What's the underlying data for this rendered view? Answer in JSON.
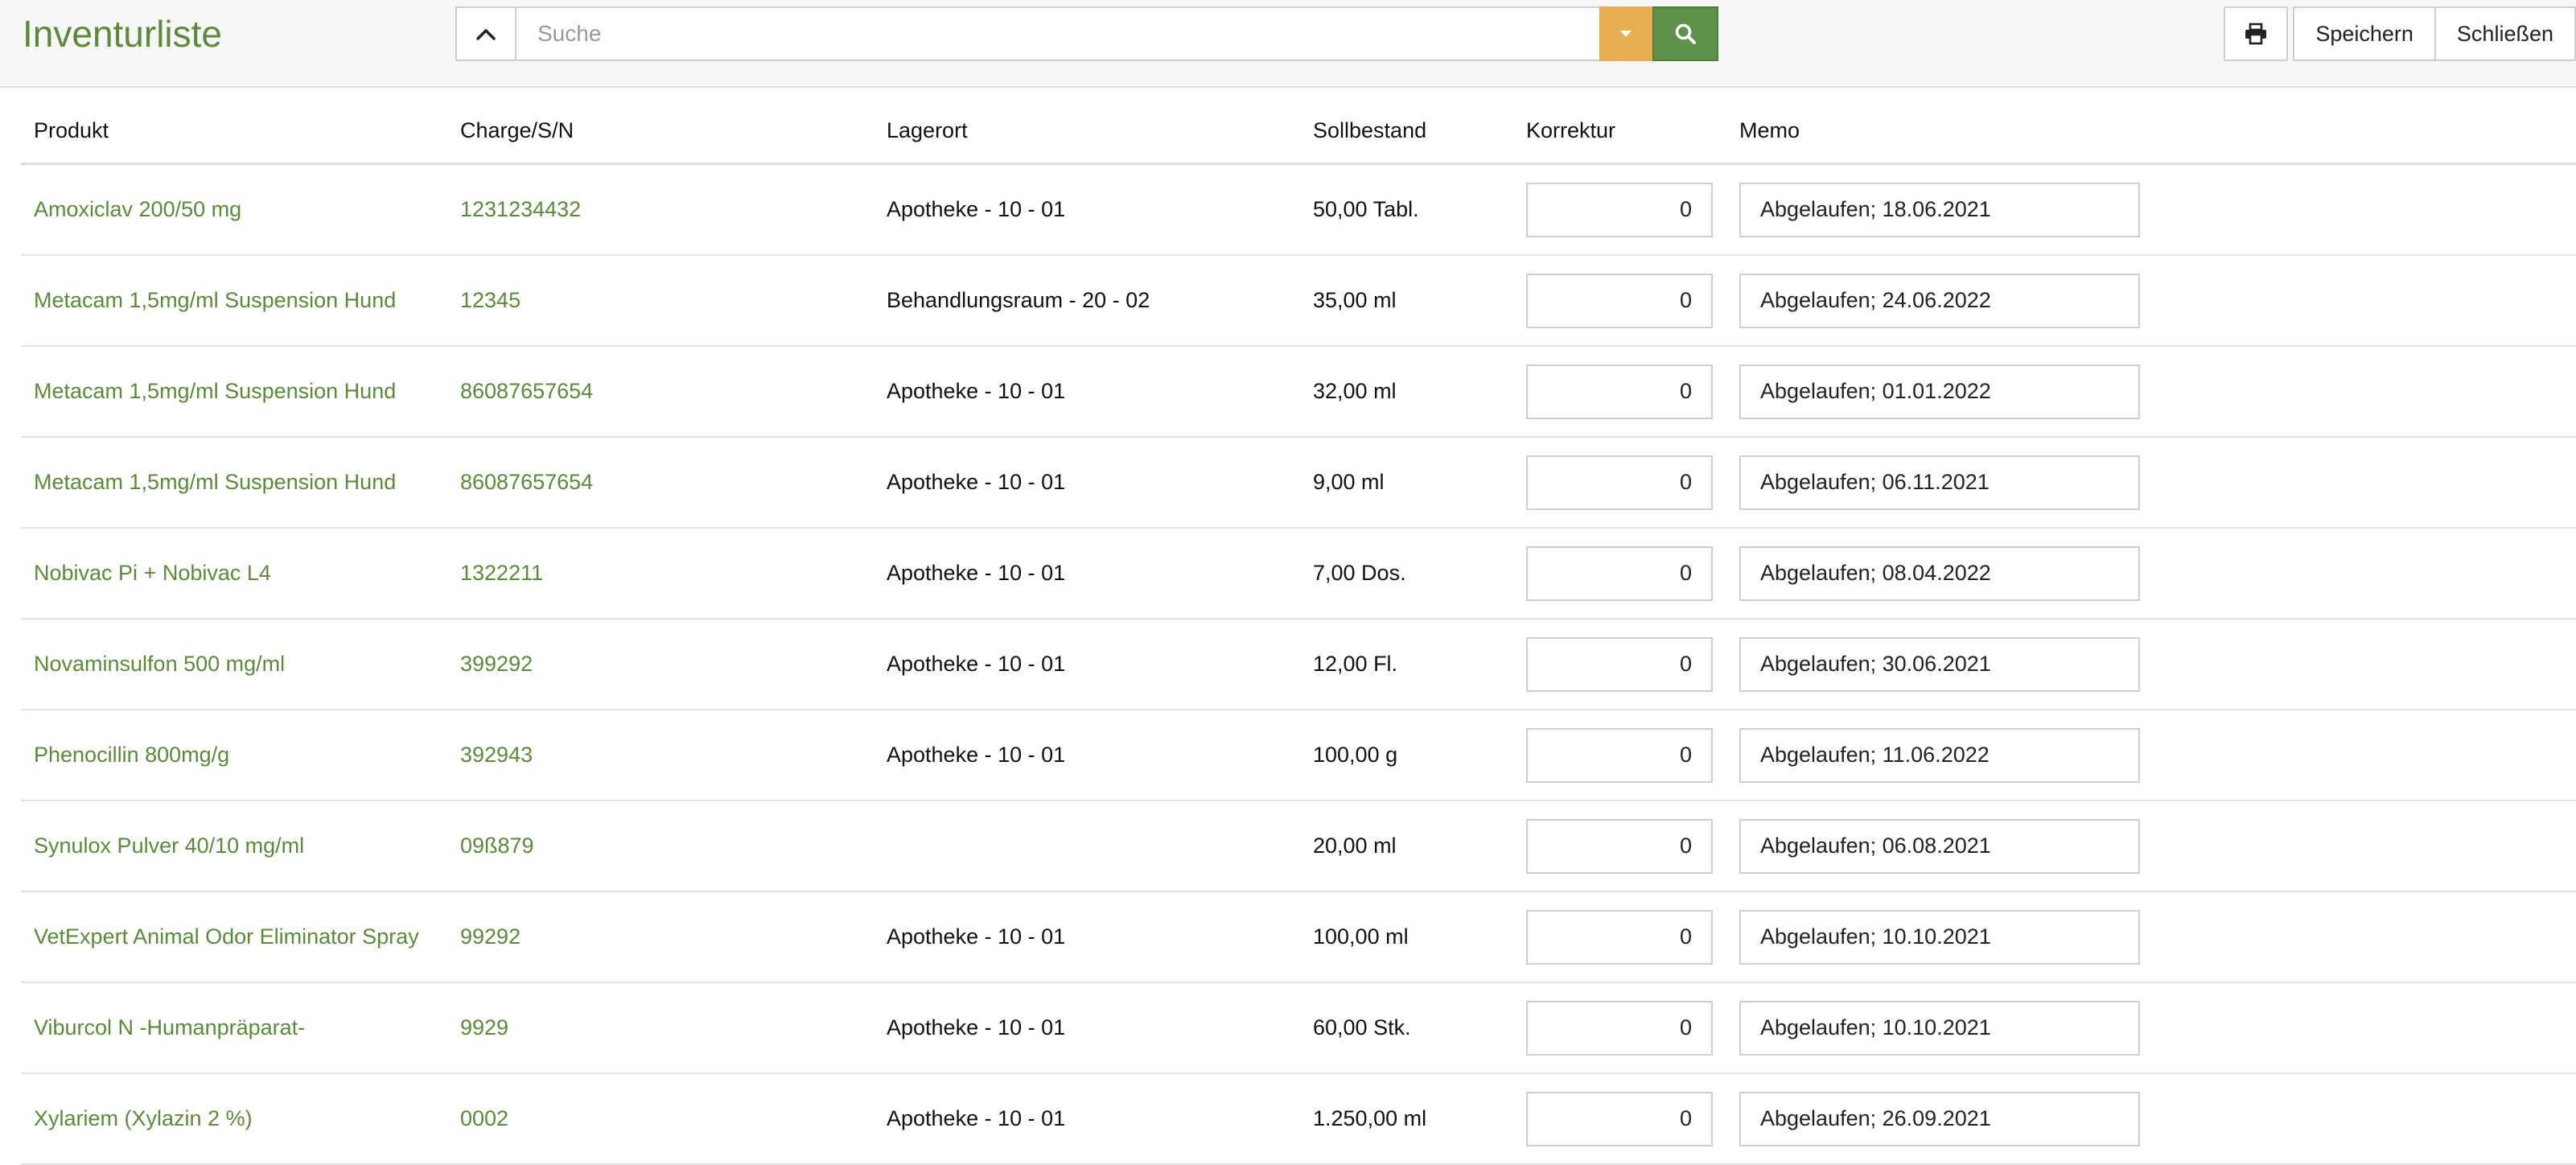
{
  "app": {
    "title": "Inventurliste"
  },
  "search": {
    "placeholder": "Suche",
    "value": ""
  },
  "toolbar": {
    "save_label": "Speichern",
    "close_label": "Schließen"
  },
  "colors": {
    "brand_green": "#5a8a3a",
    "dropdown_orange": "#e8ae52",
    "search_green": "#5e9248"
  },
  "table": {
    "headers": [
      "Produkt",
      "Charge/S/N",
      "Lagerort",
      "Sollbestand",
      "Korrektur",
      "Memo"
    ],
    "rows": [
      {
        "product": "Amoxiclav 200/50 mg",
        "charge": "1231234432",
        "location": "Apotheke - 10 - 01",
        "target": "50,00 Tabl.",
        "correction": "0",
        "memo": "Abgelaufen; 18.06.2021"
      },
      {
        "product": "Metacam 1,5mg/ml Suspension Hund",
        "charge": "12345",
        "location": "Behandlungsraum - 20 - 02",
        "target": "35,00 ml",
        "correction": "0",
        "memo": "Abgelaufen; 24.06.2022"
      },
      {
        "product": "Metacam 1,5mg/ml Suspension Hund",
        "charge": "86087657654",
        "location": "Apotheke - 10 - 01",
        "target": "32,00 ml",
        "correction": "0",
        "memo": "Abgelaufen; 01.01.2022"
      },
      {
        "product": "Metacam 1,5mg/ml Suspension Hund",
        "charge": "86087657654",
        "location": "Apotheke - 10 - 01",
        "target": "9,00 ml",
        "correction": "0",
        "memo": "Abgelaufen; 06.11.2021"
      },
      {
        "product": "Nobivac Pi + Nobivac L4",
        "charge": "1322211",
        "location": "Apotheke - 10 - 01",
        "target": "7,00 Dos.",
        "correction": "0",
        "memo": "Abgelaufen; 08.04.2022"
      },
      {
        "product": "Novaminsulfon 500 mg/ml",
        "charge": "399292",
        "location": "Apotheke - 10 - 01",
        "target": "12,00 Fl.",
        "correction": "0",
        "memo": "Abgelaufen; 30.06.2021"
      },
      {
        "product": "Phenocillin 800mg/g",
        "charge": "392943",
        "location": "Apotheke - 10 - 01",
        "target": "100,00 g",
        "correction": "0",
        "memo": "Abgelaufen; 11.06.2022"
      },
      {
        "product": "Synulox Pulver 40/10 mg/ml",
        "charge": "09ß879",
        "location": "",
        "target": "20,00 ml",
        "correction": "0",
        "memo": "Abgelaufen; 06.08.2021"
      },
      {
        "product": "VetExpert Animal Odor Eliminator Spray",
        "charge": "99292",
        "location": "Apotheke - 10 - 01",
        "target": "100,00 ml",
        "correction": "0",
        "memo": "Abgelaufen; 10.10.2021"
      },
      {
        "product": "Viburcol N -Humanpräparat-",
        "charge": "9929",
        "location": "Apotheke - 10 - 01",
        "target": "60,00 Stk.",
        "correction": "0",
        "memo": "Abgelaufen; 10.10.2021"
      },
      {
        "product": "Xylariem (Xylazin 2 %)",
        "charge": "0002",
        "location": "Apotheke - 10 - 01",
        "target": "1.250,00 ml",
        "correction": "0",
        "memo": "Abgelaufen; 26.09.2021"
      }
    ]
  }
}
